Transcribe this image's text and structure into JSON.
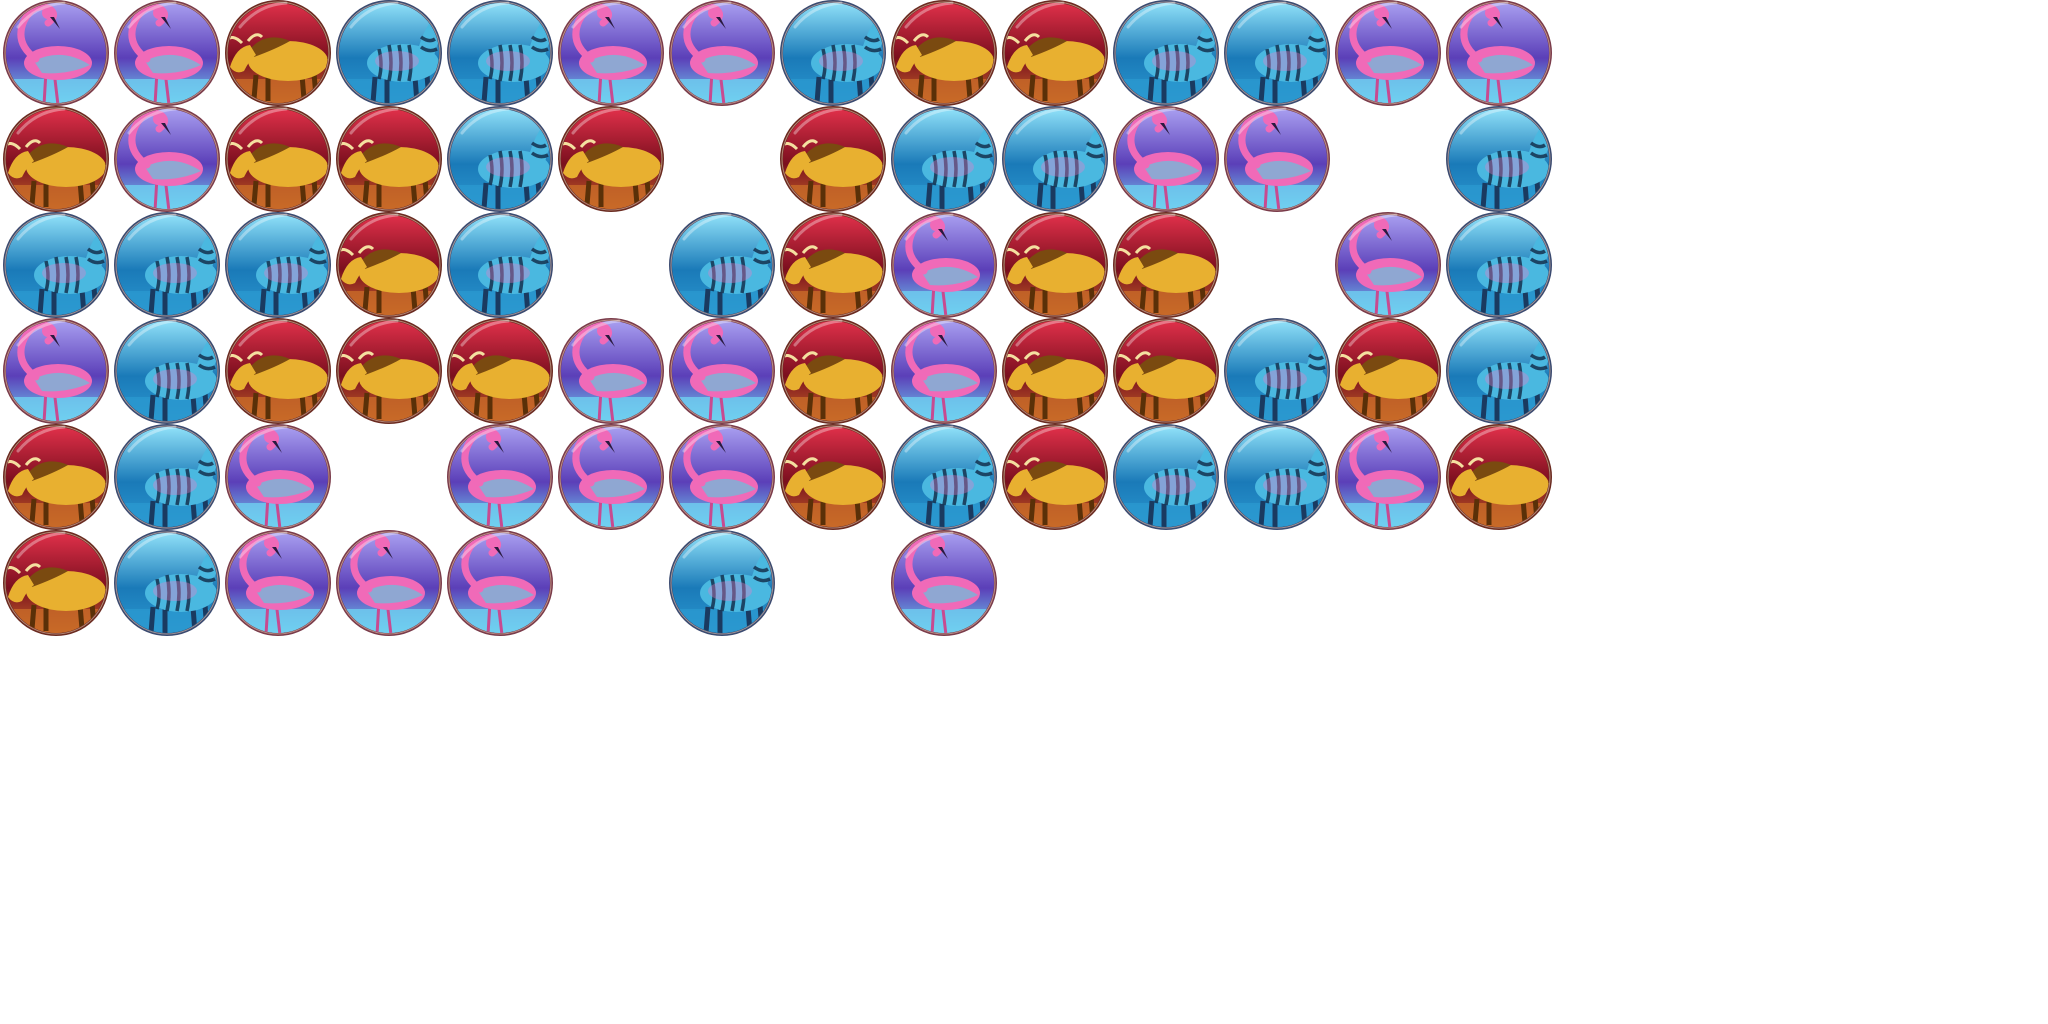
{
  "sprite_sheet": {
    "columns": 14,
    "rows": 6,
    "symbol_types": {
      "flamingo": {
        "icon": "flamingo-icon",
        "colors": {
          "rim": "#7a3b4a",
          "bg_top": "#a89ef0",
          "bg_mid": "#5b3fb8",
          "bg_low": "#6fd0f0",
          "body": "#f06ab8",
          "body_alt": "#40d8e8"
        }
      },
      "wildebeest": {
        "icon": "wildebeest-icon",
        "colors": {
          "rim": "#6a2a20",
          "bg_top": "#e0304a",
          "bg_mid": "#7a0f1e",
          "bg_low": "#c86a28",
          "body": "#e8b030",
          "body_alt": "#7a4a10"
        }
      },
      "zebra": {
        "icon": "zebra-icon",
        "colors": {
          "rim": "#3a4a70",
          "bg_top": "#8fe0f8",
          "bg_mid": "#1a7ab8",
          "bg_low": "#2b98d0",
          "body": "#4ab8e0",
          "body_alt": "#f07ac8"
        }
      }
    },
    "grid": [
      [
        "flamingo",
        "flamingo",
        "wildebeest",
        "zebra",
        "zebra",
        "flamingo",
        "flamingo",
        "zebra",
        "wildebeest",
        "wildebeest",
        "zebra",
        "zebra",
        "flamingo",
        "flamingo"
      ],
      [
        "wildebeest",
        "flamingo",
        "wildebeest",
        "wildebeest",
        "zebra",
        "wildebeest",
        null,
        "wildebeest",
        "zebra",
        "zebra",
        "flamingo",
        "flamingo",
        null,
        "zebra"
      ],
      [
        "zebra",
        "zebra",
        "zebra",
        "wildebeest",
        "zebra",
        null,
        "zebra",
        "wildebeest",
        "flamingo",
        "wildebeest",
        "wildebeest",
        null,
        "flamingo",
        "zebra"
      ],
      [
        "flamingo",
        "zebra",
        "wildebeest",
        "wildebeest",
        "wildebeest",
        "flamingo",
        "flamingo",
        "wildebeest",
        "flamingo",
        "wildebeest",
        "wildebeest",
        "zebra",
        "wildebeest",
        "zebra"
      ],
      [
        "wildebeest",
        "zebra",
        "flamingo",
        null,
        "flamingo",
        "flamingo",
        "flamingo",
        "wildebeest",
        "zebra",
        "wildebeest",
        "zebra",
        "zebra",
        "flamingo",
        "wildebeest"
      ],
      [
        "wildebeest",
        "zebra",
        "flamingo",
        "flamingo",
        "flamingo",
        null,
        "zebra",
        null,
        "flamingo",
        null,
        null,
        null,
        null,
        null
      ]
    ]
  }
}
